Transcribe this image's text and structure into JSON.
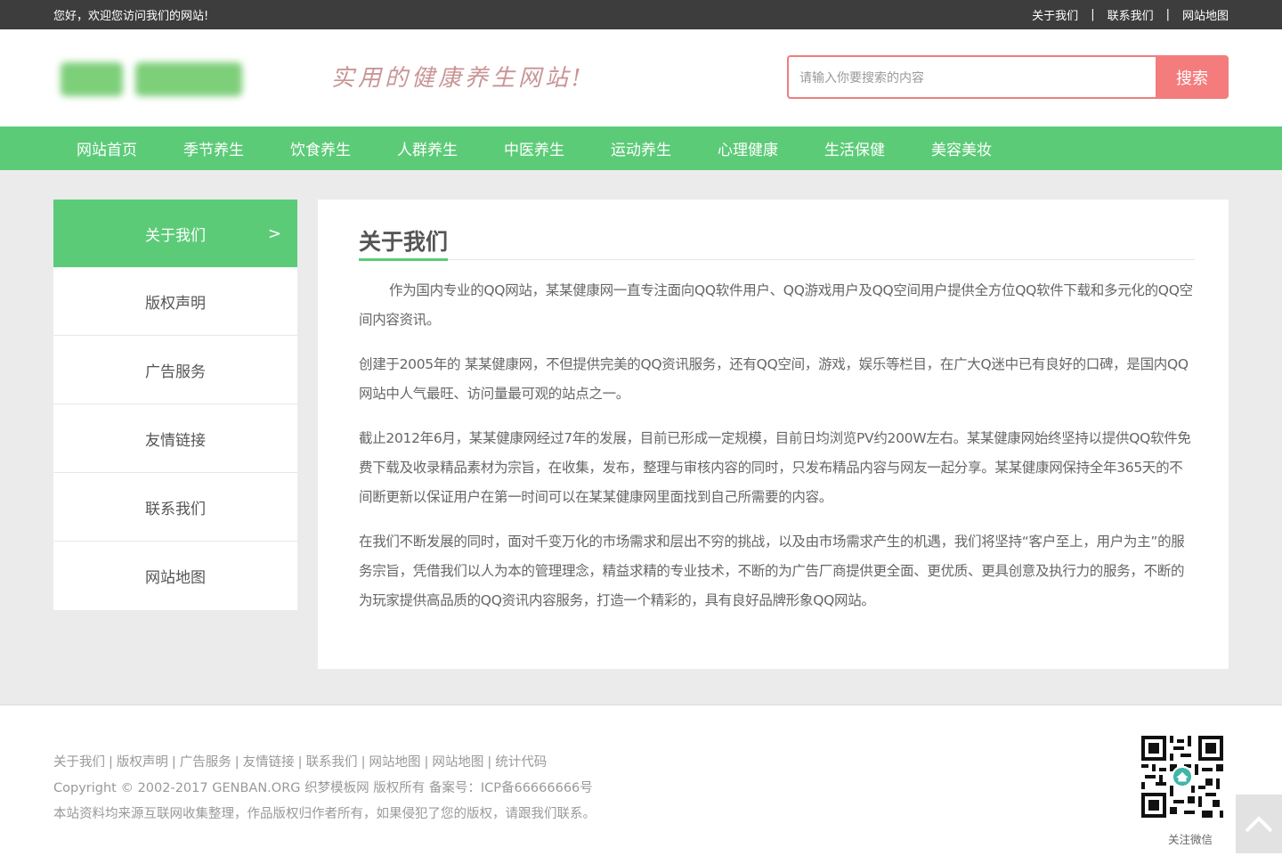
{
  "topbar": {
    "welcome": "您好，欢迎您访问我们的网站!",
    "links": [
      "关于我们",
      "联系我们",
      "网站地图"
    ],
    "separator": "|"
  },
  "header": {
    "slogan": "实用的健康养生网站!",
    "search": {
      "placeholder": "请输入你要搜索的内容",
      "button_label": "搜索"
    }
  },
  "nav": {
    "items": [
      "网站首页",
      "季节养生",
      "饮食养生",
      "人群养生",
      "中医养生",
      "运动养生",
      "心理健康",
      "生活保健",
      "美容美妆"
    ]
  },
  "sidebar": {
    "items": [
      {
        "label": "关于我们",
        "active": true,
        "arrow": ">"
      },
      {
        "label": "版权声明"
      },
      {
        "label": "广告服务"
      },
      {
        "label": "友情链接"
      },
      {
        "label": "联系我们"
      },
      {
        "label": "网站地图"
      }
    ]
  },
  "content": {
    "title": "关于我们",
    "paragraphs": [
      "作为国内专业的QQ网站，某某健康网一直专注面向QQ软件用户、QQ游戏用户及QQ空间用户提供全方位QQ软件下载和多元化的QQ空间内容资讯。",
      "创建于2005年的 某某健康网，不但提供完美的QQ资讯服务，还有QQ空间，游戏，娱乐等栏目，在广大Q迷中已有良好的口碑，是国内QQ网站中人气最旺、访问量最可观的站点之一。",
      "截止2012年6月，某某健康网经过7年的发展，目前已形成一定规模，目前日均浏览PV约200W左右。某某健康网始终坚持以提供QQ软件免费下载及收录精品素材为宗旨，在收集，发布，整理与审核内容的同时，只发布精品内容与网友一起分享。某某健康网保持全年365天的不间断更新以保证用户在第一时间可以在某某健康网里面找到自己所需要的内容。",
      "在我们不断发展的同时，面对千变万化的市场需求和层出不穷的挑战，以及由市场需求产生的机遇，我们将坚持“客户至上，用户为主”的服务宗旨，凭借我们以人为本的管理理念，精益求精的专业技术，不断的为广告厂商提供更全面、更优质、更具创意及执行力的服务，不断的为玩家提供高品质的QQ资讯内容服务，打造一个精彩的，具有良好品牌形象QQ网站。"
    ]
  },
  "footer": {
    "links": [
      "关于我们",
      "版权声明",
      "广告服务",
      "友情链接",
      "联系我们",
      "网站地图",
      "网站地图",
      "统计代码"
    ],
    "link_separator": "|",
    "copyright": "Copyright © 2002-2017 GENBAN.ORG 织梦模板网 版权所有 备案号：ICP备66666666号",
    "notice": "本站资料均来源互联网收集整理，作品版权归作者所有，如果侵犯了您的版权，请跟我们联系。",
    "qr_label": "关注微信"
  },
  "colors": {
    "accent_green": "#5ccb78",
    "accent_red": "#f47c7c",
    "topbar_bg": "#3d3d3d"
  },
  "icons": {
    "back_to_top": "chevron-up-icon",
    "qr": "qr-code-icon"
  }
}
